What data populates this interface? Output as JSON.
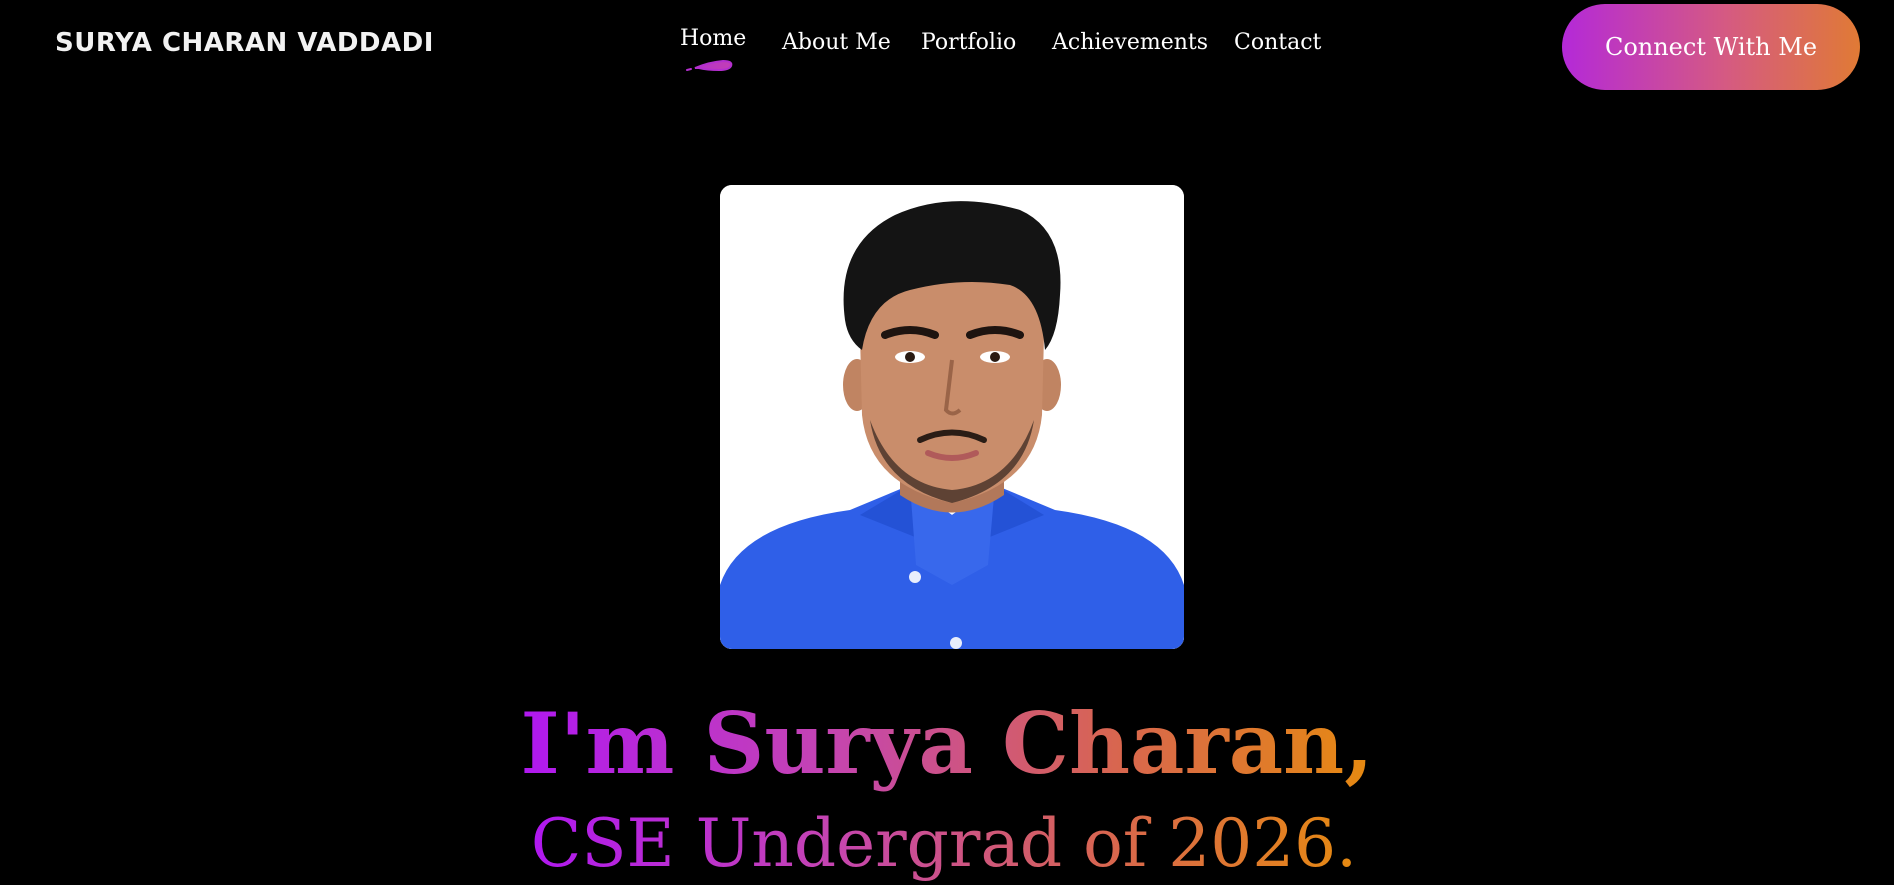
{
  "header": {
    "logo_text": "SURYA CHARAN VADDADI",
    "nav": [
      {
        "label": "Home",
        "active": true
      },
      {
        "label": "About Me"
      },
      {
        "label": "Portfolio"
      },
      {
        "label": "Achievements"
      },
      {
        "label": "Contact"
      }
    ],
    "cta_label": "Connect With Me"
  },
  "hero": {
    "headline": "I'm Surya Charan,",
    "subline": "CSE Undergrad of 2026."
  },
  "colors": {
    "background": "#000000",
    "gradient_start": "#b018f0",
    "gradient_end": "#e68a10",
    "shirt": "#2f5fe8"
  },
  "icons": {
    "active_nav_underline": "swoosh-underline"
  }
}
